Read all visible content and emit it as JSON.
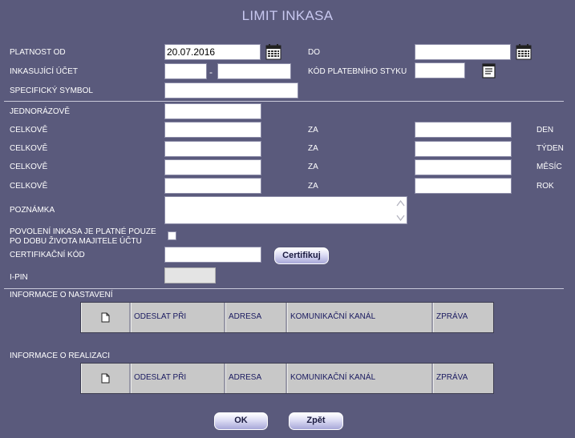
{
  "title": "LIMIT INKASA",
  "fields": {
    "platnost_od_label": "PLATNOST OD",
    "platnost_od_value": "20.07.2016",
    "do_label": "DO",
    "do_value": "",
    "inkasujici_ucet_label": "INKASUJÍCÍ ÚČET",
    "ucet_prefix_value": "",
    "ucet_separator": "-",
    "ucet_number_value": "",
    "kod_platebniho_styku_label": "KÓD PLATEBNÍHO STYKU",
    "kod_platebniho_styku_value": "",
    "specificky_symbol_label": "SPECIFICKÝ SYMBOL",
    "specificky_symbol_value": "",
    "jednorazove_label": "JEDNORÁZOVĚ",
    "jednorazove_value": ""
  },
  "limits": [
    {
      "label": "CELKOVĚ",
      "za_label": "ZA",
      "period": "DEN",
      "amount": "",
      "count": ""
    },
    {
      "label": "CELKOVĚ",
      "za_label": "ZA",
      "period": "TÝDEN",
      "amount": "",
      "count": ""
    },
    {
      "label": "CELKOVĚ",
      "za_label": "ZA",
      "period": "MĚSÍC",
      "amount": "",
      "count": ""
    },
    {
      "label": "CELKOVĚ",
      "za_label": "ZA",
      "period": "ROK",
      "amount": "",
      "count": ""
    }
  ],
  "poznamka_label": "POZNÁMKA",
  "poznamka_value": "",
  "povoleni_label_line1": "POVOLENÍ INKASA JE PLATNÉ POUZE",
  "povoleni_label_line2": "PO DOBU ŽIVOTA MAJITELE ÚČTU",
  "povoleni_checked": false,
  "certifikacni_kod_label": "CERTIFIKAČNÍ KÓD",
  "certifikacni_kod_value": "",
  "certifikuj_button": "Certifikuj",
  "ipin_label": "I-PIN",
  "ipin_value": "",
  "nastaveni_section_label": "INFORMACE O NASTAVENÍ",
  "realizace_section_label": "INFORMACE O REALIZACI",
  "table_columns": [
    "ODESLAT PŘI",
    "ADRESA",
    "KOMUNIKAČNÍ KANÁL",
    "ZPRÁVA"
  ],
  "ok_button": "OK",
  "zpet_button": "Zpět",
  "icons": {
    "calendar": "calendar-icon",
    "lookup": "list-lookup-icon",
    "new_document": "new-document-icon"
  },
  "colors": {
    "background": "#5a5a7c",
    "title": "#c8c8f0",
    "table_bg": "#c8c8c8",
    "table_text": "#1a1a60"
  }
}
